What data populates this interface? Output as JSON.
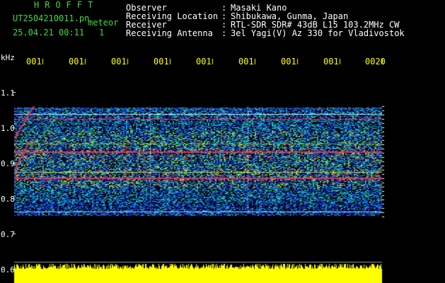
{
  "header": {
    "brand": "HROFFT",
    "file_name": "UT2504210011.pn",
    "type_label": "meteor",
    "date_time": "25.04.21 00:11",
    "channel": "1"
  },
  "station": {
    "rows": [
      {
        "label": "Observer",
        "value": "Masaki Kano"
      },
      {
        "label": "Receiving Location",
        "value": "Shibukawa, Gunma, Japan"
      },
      {
        "label": "Receiver",
        "value": "RTL-SDR SDR# 43dB L15 103.2MHz CW"
      },
      {
        "label": "Receiving Antenna",
        "value": "3el Yagi(V) Az 330 for Vladivostok"
      }
    ]
  },
  "axes": {
    "y_unit": "kHz",
    "y_ticks": [
      "1.1",
      "1.0",
      "0.9",
      "0.8",
      "0.7",
      "0.6"
    ],
    "x_ticks": [
      "001",
      "001",
      "001",
      "001",
      "001",
      "001",
      "001",
      "001",
      "0020"
    ]
  },
  "colors": {
    "background": "#000000",
    "header_green": "#3ddc3d",
    "tick_yellow": "#ffff00",
    "text_white": "#ffffff"
  }
}
